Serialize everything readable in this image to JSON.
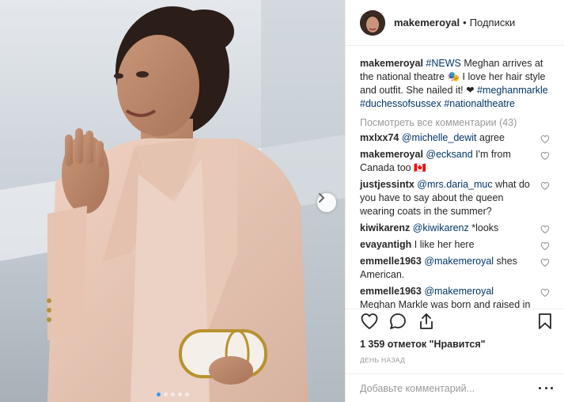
{
  "post": {
    "username": "makemeroyal",
    "separator": "•",
    "follow_label": "Подписки"
  },
  "caption": {
    "username": "makemeroyal",
    "tag1": "#NEWS",
    "text1": " Meghan arrives at the national theatre 🎭 I love her hair style and outfit. She nailed it! ❤ ",
    "tag2": "#meghanmarkle",
    "tag3": "#duchessofsussex",
    "tag4": "#nationaltheatre"
  },
  "view_all_comments": "Посмотреть все комментарии (43)",
  "comments": [
    {
      "user": "mxlxx74",
      "mention": "@michelle_dewit",
      "text": " agree"
    },
    {
      "user": "makemeroyal",
      "mention": "@ecksand",
      "text": " I'm from Canada too 🇨🇦"
    },
    {
      "user": "justjessintx",
      "mention": "@mrs.daria_muc",
      "text": " what do you have to say about the queen wearing coats in the summer?"
    },
    {
      "user": "kiwikarenz",
      "mention": "@kiwikarenz",
      "text": " *looks"
    },
    {
      "user": "evayantigh",
      "mention": "",
      "text": "I like her here"
    },
    {
      "user": "emmelle1963",
      "mention": "@makemeroyal",
      "text": " shes American."
    },
    {
      "user": "emmelle1963",
      "mention": "@makemeroyal",
      "text": " Meghan Markle was born and raised in Los Angeles, California"
    }
  ],
  "likes": "1 359 отметок \"Нравится\"",
  "timestamp": "день назад",
  "add_comment": {
    "placeholder": "Добавьте комментарий..."
  },
  "icons": {
    "like": "heart-icon",
    "comment": "comment-icon",
    "share": "share-icon",
    "save": "bookmark-icon",
    "next": "chevron-right-icon",
    "more": "more-icon"
  },
  "carousel": {
    "count": 5,
    "active": 0
  },
  "colors": {
    "link": "#003569",
    "active_dot": "#3897f0",
    "muted": "#999999"
  }
}
